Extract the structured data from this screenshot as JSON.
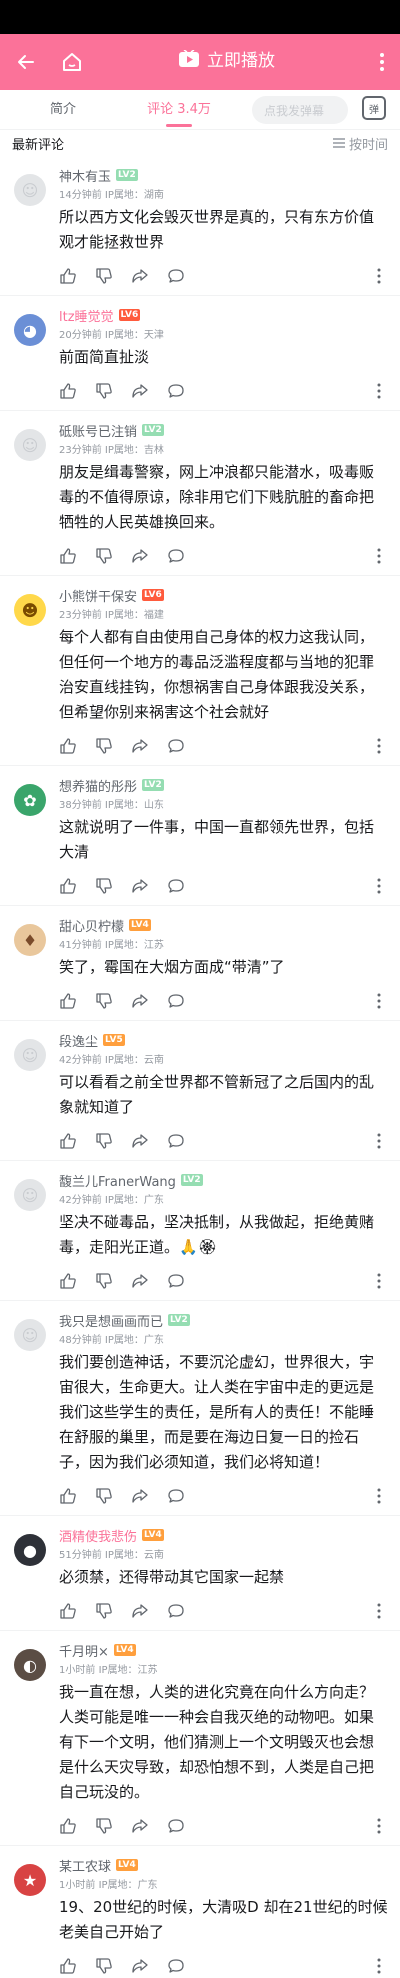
{
  "header": {
    "play_label": "立即播放"
  },
  "tabs": [
    {
      "label": "简介"
    },
    {
      "label": "评论 3.4万"
    }
  ],
  "danmaku": {
    "placeholder": "点我发弹幕",
    "button": "弹"
  },
  "list": {
    "title": "最新评论",
    "sort": "按时间"
  },
  "colors": {
    "accent": "#fb7299",
    "lv2": "#95ddb2",
    "lv5": "#ff9f3d",
    "lv6": "#ff5b3d"
  },
  "comments": [
    {
      "user": "神木有玉",
      "level": "LV2",
      "time": "14分钟前",
      "ip": "IP属地：湖南",
      "text": "所以西方文化会毁灭世界是真的，只有东方价值观才能拯救世界",
      "vip": false,
      "avatar": "default-avatar"
    },
    {
      "user": "ltz睡觉觉",
      "level": "LV6",
      "time": "20分钟前",
      "ip": "IP属地：天津",
      "text": "前面简直扯淡",
      "vip": true,
      "avatar": "blue-cartoon-avatar"
    },
    {
      "user": "砥账号已注销",
      "level": "LV2",
      "time": "23分钟前",
      "ip": "IP属地：吉林",
      "text": "朋友是缉毒警察，网上冲浪都只能潜水，吸毒贩毒的不值得原谅，除非用它们下贱肮脏的畜命把牺牲的人民英雄换回来。",
      "vip": false,
      "avatar": "default-avatar"
    },
    {
      "user": "小熊饼干保安",
      "level": "LV6",
      "time": "23分钟前",
      "ip": "IP属地：福建",
      "text": "每个人都有自由使用自己身体的权力这我认同，但任何一个地方的毒品泛滥程度都与当地的犯罪治安直线挂钩，你想祸害自己身体跟我没关系，但希望你别来祸害这个社会就好",
      "vip": false,
      "avatar": "smiley-avatar"
    },
    {
      "user": "想养猫的彤彤",
      "level": "LV2",
      "time": "38分钟前",
      "ip": "IP属地：山东",
      "text": "这就说明了一件事，中国一直都领先世界，包括大清",
      "vip": false,
      "avatar": "green-avatar"
    },
    {
      "user": "甜心贝柠檬",
      "level": "LV4",
      "time": "41分钟前",
      "ip": "IP属地：江苏",
      "text": "笑了，霉国在大烟方面成“带清”了",
      "vip": false,
      "avatar": "anime-avatar"
    },
    {
      "user": "段逸尘",
      "level": "LV5",
      "time": "42分钟前",
      "ip": "IP属地：云南",
      "text": "可以看看之前全世界都不管新冠了之后国内的乱象就知道了",
      "vip": false,
      "avatar": "default-avatar"
    },
    {
      "user": "馥兰儿FranerWang",
      "level": "LV2",
      "time": "42分钟前",
      "ip": "IP属地：广东",
      "text": "坚决不碰毒品，坚决抵制，从我做起，拒绝黄赌毒，走阳光正道。",
      "vip": false,
      "avatar": "default-avatar"
    },
    {
      "user": "我只是想画画而已",
      "level": "LV2",
      "time": "48分钟前",
      "ip": "IP属地：广东",
      "text": "我们要创造神话，不要沉沦虚幻，世界很大，宇宙很大，生命更大。让人类在宇宙中走的更远是我们这些学生的责任，是所有人的责任！不能睡在舒服的巢里，而是要在海边日复一日的捡石子，因为我们必须知道，我们必将知道！",
      "vip": false,
      "avatar": "default-avatar"
    },
    {
      "user": "酒精使我悲伤",
      "level": "LV4",
      "time": "51分钟前",
      "ip": "IP属地：云南",
      "text": "必须禁，还得带动其它国家一起禁",
      "vip": true,
      "avatar": "dark-avatar"
    },
    {
      "user": "千月明×",
      "level": "LV4",
      "time": "1小时前",
      "ip": "IP属地：江苏",
      "text": "我一直在想，人类的进化究竟在向什么方向走？人类可能是唯一一种会自我灭绝的动物吧。如果有下一个文明，他们猜测上一个文明毁灭也会想是什么天灾导致，却恐怕想不到，人类是自己把自己玩没的。",
      "vip": false,
      "avatar": "portrait-avatar"
    },
    {
      "user": "某工农球",
      "level": "LV4",
      "time": "1小时前",
      "ip": "IP属地：广东",
      "text": "19、20世纪的时候，大清吸D 却在21世纪的时候老美自己开始了",
      "vip": false,
      "avatar": "flag-avatar"
    }
  ]
}
